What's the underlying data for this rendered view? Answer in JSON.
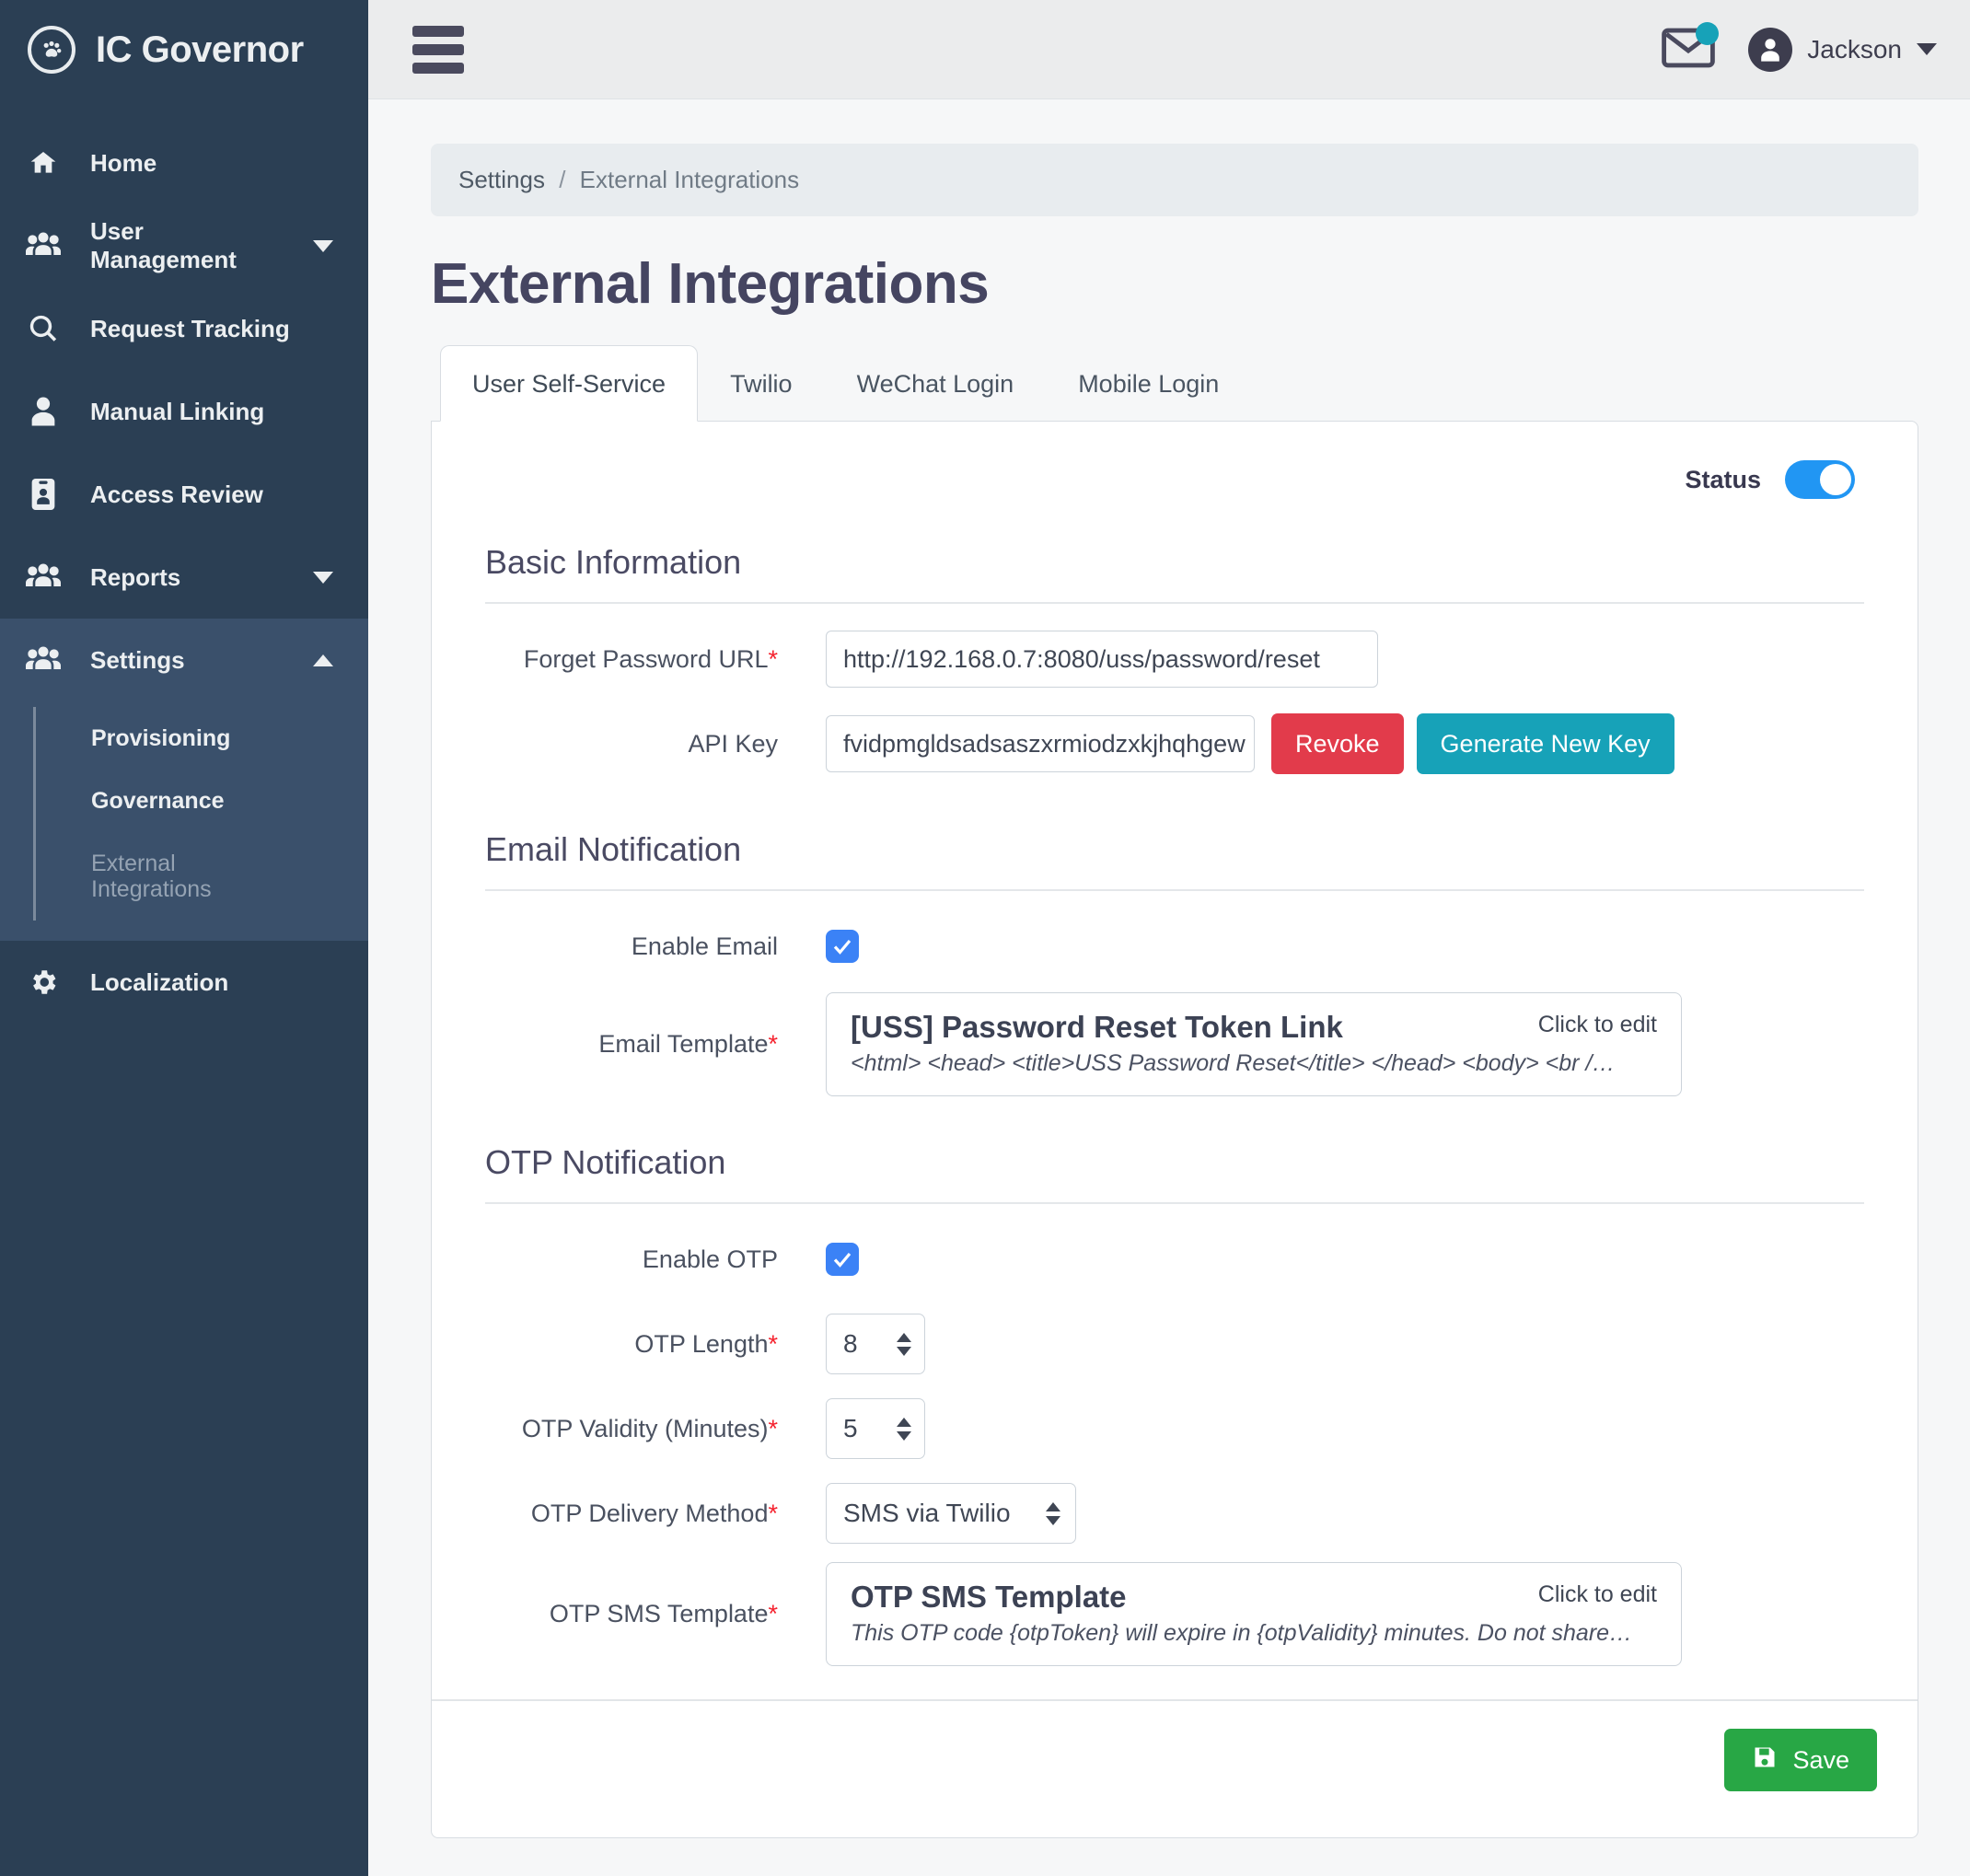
{
  "brand": {
    "name": "IC Governor",
    "logo_icon": "paw-circle-icon"
  },
  "sidebar": {
    "items": [
      {
        "label": "Home",
        "icon": "home-icon",
        "has_caret": false
      },
      {
        "label": "User Management",
        "icon": "users-icon",
        "has_caret": true,
        "caret": "down"
      },
      {
        "label": "Request Tracking",
        "icon": "search-icon",
        "has_caret": false
      },
      {
        "label": "Manual Linking",
        "icon": "user-icon",
        "has_caret": false
      },
      {
        "label": "Access Review",
        "icon": "id-badge-icon",
        "has_caret": false
      },
      {
        "label": "Reports",
        "icon": "users-icon",
        "has_caret": true,
        "caret": "down"
      },
      {
        "label": "Settings",
        "icon": "users-icon",
        "has_caret": true,
        "caret": "up",
        "expanded": true
      },
      {
        "label": "Localization",
        "icon": "gear-icon",
        "has_caret": false
      }
    ],
    "settings_submenu": [
      {
        "label": "Provisioning",
        "active": false
      },
      {
        "label": "Governance",
        "active": false
      },
      {
        "label": "External Integrations",
        "active": true
      }
    ]
  },
  "topbar": {
    "menu_icon": "hamburger-icon",
    "mail_icon": "envelope-icon",
    "mail_badge": "",
    "user_name": "Jackson",
    "avatar_icon": "user-avatar-icon"
  },
  "breadcrumb": {
    "parent": "Settings",
    "separator": "/",
    "current": "External Integrations"
  },
  "page": {
    "title": "External Integrations"
  },
  "tabs": [
    {
      "label": "User Self-Service",
      "active": true
    },
    {
      "label": "Twilio",
      "active": false
    },
    {
      "label": "WeChat Login",
      "active": false
    },
    {
      "label": "Mobile Login",
      "active": false
    }
  ],
  "status": {
    "label": "Status",
    "enabled": true
  },
  "basic_information": {
    "heading": "Basic Information",
    "forget_password_url": {
      "label": "Forget Password URL",
      "required": "*",
      "value": "http://192.168.0.7:8080/uss/password/reset"
    },
    "api_key": {
      "label": "API Key",
      "value": "fvidpmgldsadsaszxrmiodzxkjhqhgew",
      "revoke_label": "Revoke",
      "generate_label": "Generate New Key"
    }
  },
  "email_notification": {
    "heading": "Email Notification",
    "enable_email": {
      "label": "Enable Email",
      "checked": true
    },
    "email_template": {
      "label": "Email Template",
      "required": "*",
      "title": "[USS] Password Reset Token Link",
      "preview": "<html> <head> <title>USS Password Reset</title> </head> <body> <br /…",
      "edit_hint": "Click to edit"
    }
  },
  "otp_notification": {
    "heading": "OTP Notification",
    "enable_otp": {
      "label": "Enable OTP",
      "checked": true
    },
    "otp_length": {
      "label": "OTP Length",
      "required": "*",
      "value": "8"
    },
    "otp_validity": {
      "label": "OTP Validity (Minutes)",
      "required": "*",
      "value": "5"
    },
    "otp_delivery_method": {
      "label": "OTP Delivery Method",
      "required": "*",
      "value": "SMS via Twilio"
    },
    "otp_sms_template": {
      "label": "OTP SMS Template",
      "required": "*",
      "title": "OTP SMS Template",
      "preview": "This OTP code {otpToken} will expire in {otpValidity} minutes. Do not share…",
      "edit_hint": "Click to edit"
    }
  },
  "footer": {
    "save_label": "Save",
    "save_icon": "floppy-disk-icon"
  },
  "colors": {
    "sidebar_bg": "#2b3f54",
    "sidebar_active": "#3a506b",
    "accent_teal": "#17a2b8",
    "danger_red": "#e23b4b",
    "success_green": "#28a745",
    "toggle_blue": "#2196f3",
    "checkbox_blue": "#3b82f6",
    "required_red": "#f5232f"
  }
}
